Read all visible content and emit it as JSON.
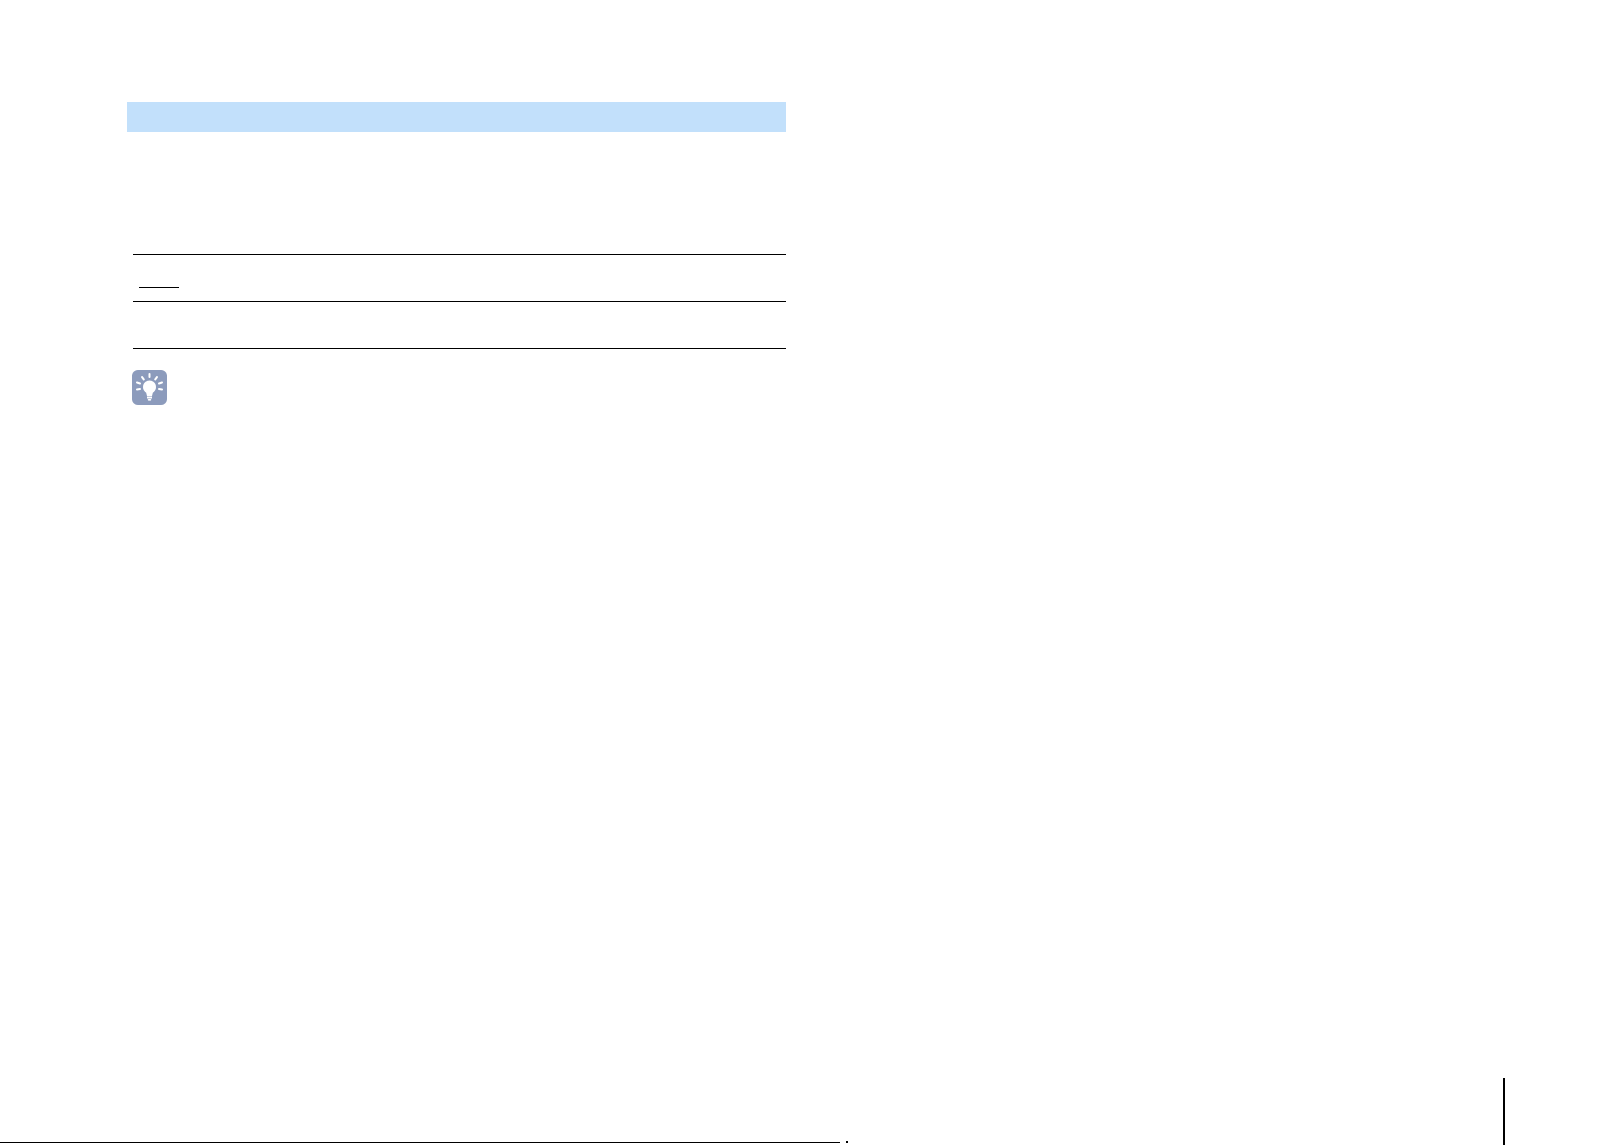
{
  "section": {
    "title": "",
    "body": ""
  },
  "table": {
    "rows": [
      {
        "text": ""
      },
      {
        "text": ""
      }
    ]
  },
  "hint": {
    "icon": "lightbulb-icon",
    "text": "",
    "icon_bg": "#8c9bbc"
  },
  "footer": {
    "page_number": ""
  },
  "colors": {
    "header_band": "#c2e0fb",
    "rule": "#000000"
  }
}
